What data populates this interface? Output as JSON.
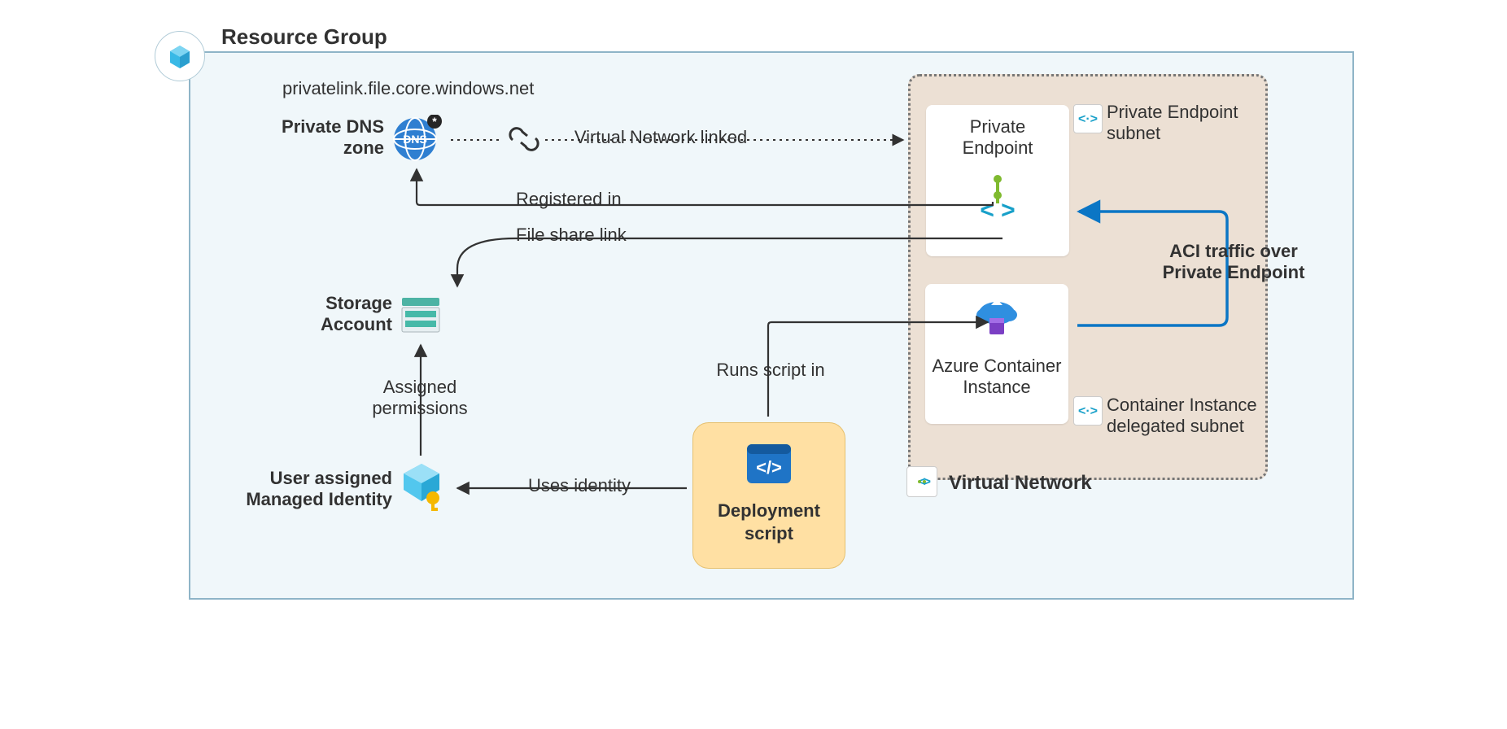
{
  "resourceGroup": {
    "title": "Resource Group"
  },
  "dns": {
    "title": "Private DNS\nzone",
    "domain": "privatelink.file.core.windows.net"
  },
  "storage": {
    "title": "Storage\nAccount"
  },
  "identity": {
    "title": "User assigned\nManaged Identity"
  },
  "deploy": {
    "title": "Deployment\nscript"
  },
  "vnet": {
    "title": "Virtual Network",
    "peSubnet": "Private Endpoint\nsubnet",
    "ciSubnet": "Container Instance\ndelegated subnet",
    "peLabel": "Private\nEndpoint",
    "ciLabel": "Azure Container\nInstance"
  },
  "edges": {
    "vnetLinked": "Virtual Network linked",
    "registeredIn": "Registered in",
    "fileShareLink": "File share link",
    "assignedPermissions": "Assigned\npermissions",
    "usesIdentity": "Uses identity",
    "runsScriptIn": "Runs script in",
    "aciTraffic": "ACI traffic over\nPrivate Endpoint"
  },
  "colors": {
    "accentBlue": "#0b76c5",
    "dnsBlue": "#2f7fd1",
    "storageTeal": "#46b9a8",
    "identityBlue": "#36c5f0",
    "identityKey": "#f5b800",
    "deployBg": "#ffe0a3",
    "vnetBg": "#ece0d4"
  }
}
